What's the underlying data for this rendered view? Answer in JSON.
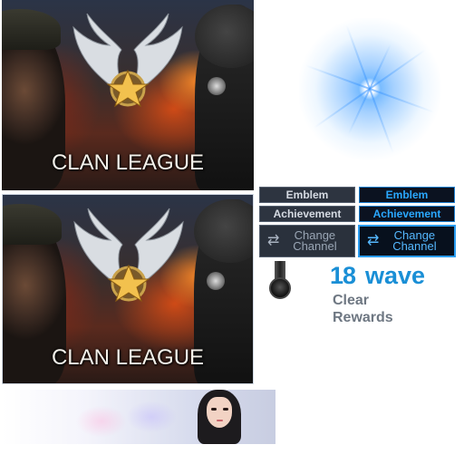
{
  "banner": {
    "logo_text": "CLAN LEAGUE"
  },
  "buttons": {
    "emblem": "Emblem",
    "achievement": "Achievement",
    "change_channel": "Change Channel"
  },
  "wave": {
    "number": "18",
    "word": "wave",
    "sub": "Clear Rewards"
  },
  "colors": {
    "accent_blue": "#1a8fd6",
    "button_gray_bg": "#2d3440",
    "button_blue_text": "#2aa8ff"
  },
  "icons": [
    "swap-arrows-icon",
    "medal-icon",
    "wings-star-emblem-icon",
    "light-flare-icon"
  ]
}
